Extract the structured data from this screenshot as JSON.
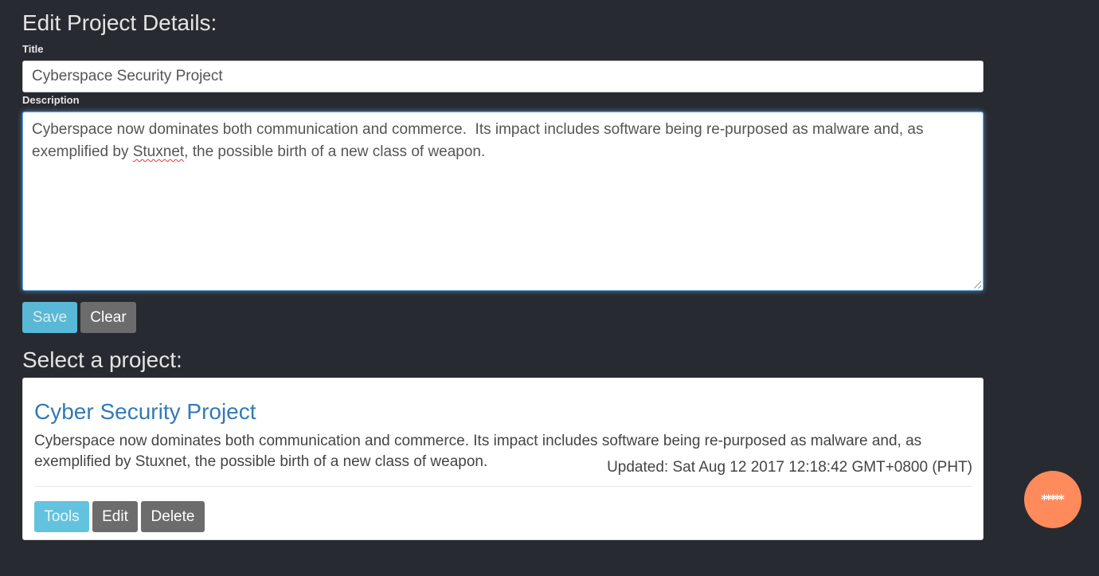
{
  "edit_form": {
    "heading": "Edit Project Details:",
    "title_label": "Title",
    "title_value": "Cyberspace Security Project",
    "description_label": "Description",
    "description_before": "Cyberspace now dominates both communication and commerce.  Its impact includes software being re-purposed as malware and, as exemplified by ",
    "description_flagged_word": "Stuxnet",
    "description_after": ", the possible birth of a new class of weapon.",
    "save_label": "Save",
    "clear_label": "Clear"
  },
  "project_list": {
    "heading": "Select a project:",
    "projects": [
      {
        "title": "Cyber Security Project",
        "description": "Cyberspace now dominates both communication and commerce. Its impact includes software being re-purposed as malware and, as exemplified by Stuxnet, the possible birth of a new class of weapon.",
        "updated": "Updated: Sat Aug 12 2017 12:18:42 GMT+0800 (PHT)",
        "tools_label": "Tools",
        "edit_label": "Edit",
        "delete_label": "Delete"
      }
    ]
  },
  "fab": {
    "label": "*****",
    "color": "#ff8a5c"
  },
  "colors": {
    "page_background": "#282a31",
    "link": "#337ab7",
    "info_button": "#5bc0de",
    "secondary_button": "#6c6c6c",
    "focus_border": "#66afe9"
  }
}
